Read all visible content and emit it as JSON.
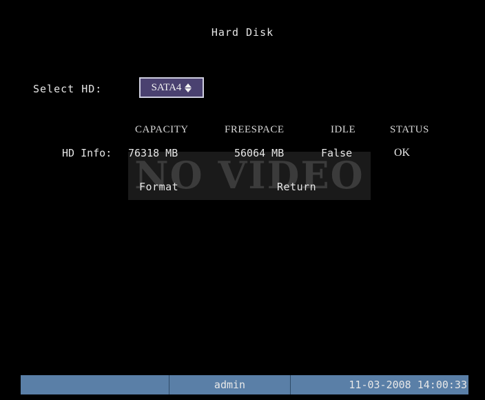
{
  "screen": {
    "title": "Hard Disk",
    "watermark": "NO VIDEO"
  },
  "select_hd": {
    "label": "Select HD:",
    "value": "SATA4"
  },
  "table": {
    "columns": [
      "CAPACITY",
      "FREESPACE",
      "IDLE",
      "STATUS"
    ],
    "row_label": "HD Info:",
    "row": {
      "capacity": "76318 MB",
      "freespace": "56064 MB",
      "idle": "False",
      "status": "OK"
    }
  },
  "buttons": {
    "format": "Format",
    "return": "Return"
  },
  "statusbar": {
    "segment1": "",
    "user": "admin",
    "datetime": "11-03-2008 14:00:33"
  },
  "colors": {
    "background": "#000000",
    "select_fill": "#4a4170",
    "statusbar": "#5a7fa7"
  }
}
